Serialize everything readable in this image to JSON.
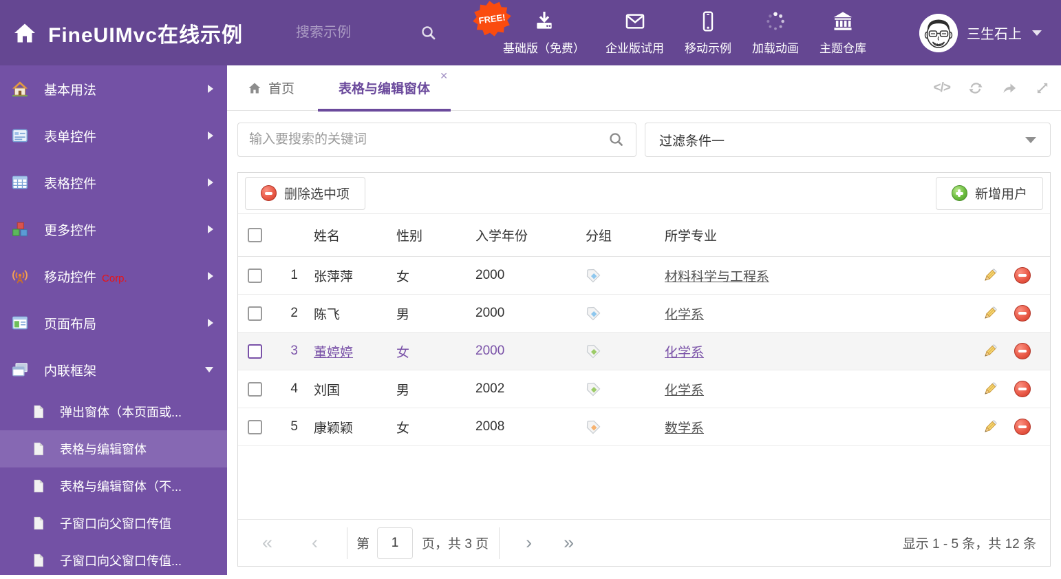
{
  "header": {
    "title": "FineUIMvc在线示例",
    "search_placeholder": "搜索示例",
    "free_badge": "FREE!",
    "nav": [
      {
        "label": "基础版（免费）"
      },
      {
        "label": "企业版试用"
      },
      {
        "label": "移动示例"
      },
      {
        "label": "加载动画"
      },
      {
        "label": "主题仓库"
      }
    ],
    "username": "三生石上"
  },
  "sidebar": {
    "items": [
      {
        "label": "基本用法"
      },
      {
        "label": "表单控件"
      },
      {
        "label": "表格控件"
      },
      {
        "label": "更多控件"
      },
      {
        "label": "移动控件",
        "badge": "Corp."
      },
      {
        "label": "页面布局"
      },
      {
        "label": "内联框架",
        "expanded": true
      }
    ],
    "subitems": [
      {
        "label": "弹出窗体（本页面或..."
      },
      {
        "label": "表格与编辑窗体",
        "active": true
      },
      {
        "label": "表格与编辑窗体（不..."
      },
      {
        "label": "子窗口向父窗口传值"
      },
      {
        "label": "子窗口向父窗口传值..."
      }
    ]
  },
  "tabs": {
    "home": "首页",
    "active": "表格与编辑窗体",
    "close": "✕"
  },
  "filter": {
    "search_placeholder": "输入要搜索的关键词",
    "selected": "过滤条件一"
  },
  "grid": {
    "buttons": {
      "delete": "删除选中项",
      "add": "新增用户"
    },
    "columns": [
      "姓名",
      "性别",
      "入学年份",
      "分组",
      "所学专业"
    ],
    "rows": [
      {
        "num": "1",
        "name": "张萍萍",
        "gender": "女",
        "year": "2000",
        "tag": "#8ec7ee",
        "major": "材料科学与工程系"
      },
      {
        "num": "2",
        "name": "陈飞",
        "gender": "男",
        "year": "2000",
        "tag": "#8ec7ee",
        "major": "化学系"
      },
      {
        "num": "3",
        "name": "董婷婷",
        "gender": "女",
        "year": "2000",
        "tag": "#9ccb68",
        "major": "化学系",
        "highlighted": true
      },
      {
        "num": "4",
        "name": "刘国",
        "gender": "男",
        "year": "2002",
        "tag": "#9ccb68",
        "major": "化学系"
      },
      {
        "num": "5",
        "name": "康颖颖",
        "gender": "女",
        "year": "2008",
        "tag": "#f6b26f",
        "major": "数学系"
      }
    ],
    "pager": {
      "prefix": "第",
      "page": "1",
      "suffix": "页，共 3 页",
      "first": "«",
      "prev": "‹",
      "next": "›",
      "last": "»",
      "summary": "显示 1 - 5 条，共 12 条"
    }
  },
  "colors": {
    "header_bg": "#654792",
    "sidebar_bg": "#7351a5",
    "accent": "#6b4a9c"
  }
}
